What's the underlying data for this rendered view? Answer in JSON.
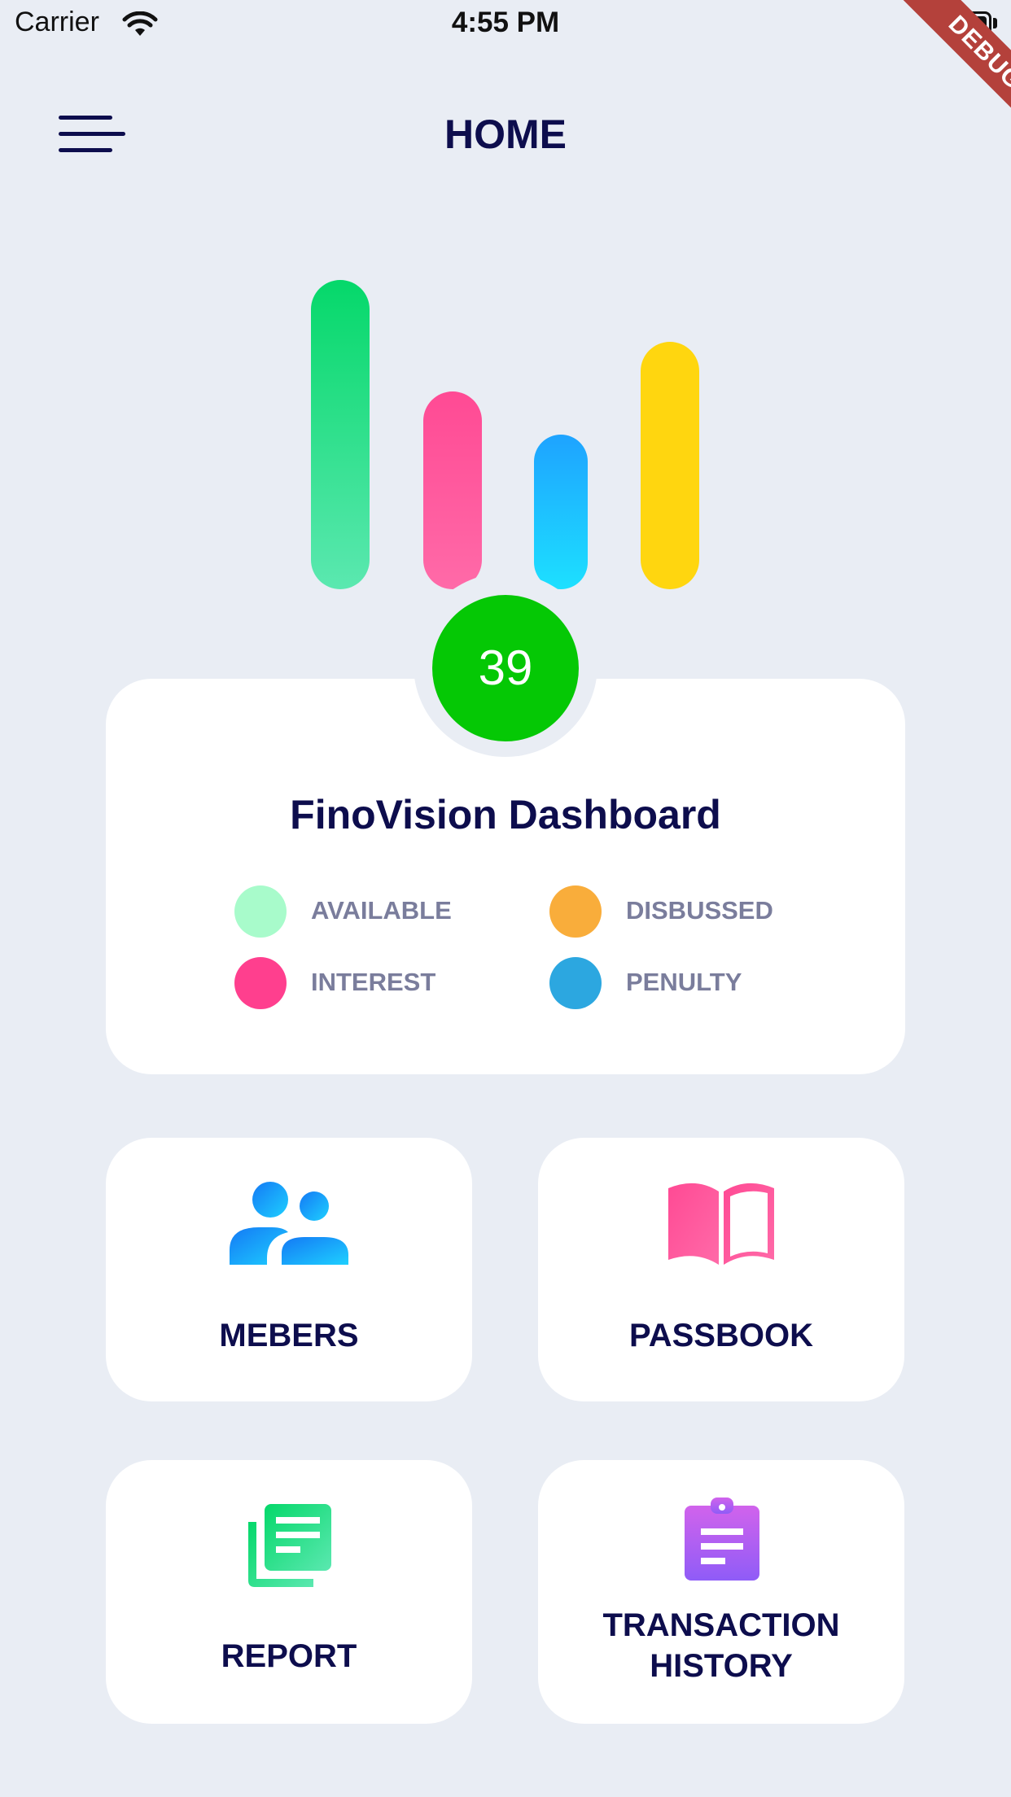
{
  "status_bar": {
    "carrier": "Carrier",
    "time": "4:55 PM"
  },
  "debug_banner": "DEBUG",
  "header": {
    "title": "HOME"
  },
  "chart_data": {
    "type": "bar",
    "categories": [
      "AVAILABLE",
      "INTEREST",
      "PENULTY",
      "DISBUSSED"
    ],
    "values": [
      100,
      64,
      50,
      80
    ],
    "colors": [
      [
        "#05d86a",
        "#5be8b0"
      ],
      [
        "#ff4a94",
        "#ff6aa8"
      ],
      [
        "#1ea3ff",
        "#1de0ff"
      ],
      [
        "#ffd60f",
        "#ffd60f"
      ]
    ]
  },
  "dashboard": {
    "count": "39",
    "title": "FinoVision Dashboard",
    "legend": [
      {
        "label": "AVAILABLE",
        "color": "#a8fbcb"
      },
      {
        "label": "DISBUSSED",
        "color": "#f9ad3b"
      },
      {
        "label": "INTEREST",
        "color": "#ff3f8e"
      },
      {
        "label": "PENULTY",
        "color": "#2ca7e0"
      }
    ]
  },
  "tiles": {
    "members": {
      "label": "MEBERS",
      "icon": "members-icon"
    },
    "passbook": {
      "label": "PASSBOOK",
      "icon": "book-icon"
    },
    "report": {
      "label": "REPORT",
      "icon": "report-icon"
    },
    "transaction_history": {
      "line1": "TRANSACTION",
      "line2": "HISTORY",
      "icon": "clipboard-icon"
    }
  }
}
